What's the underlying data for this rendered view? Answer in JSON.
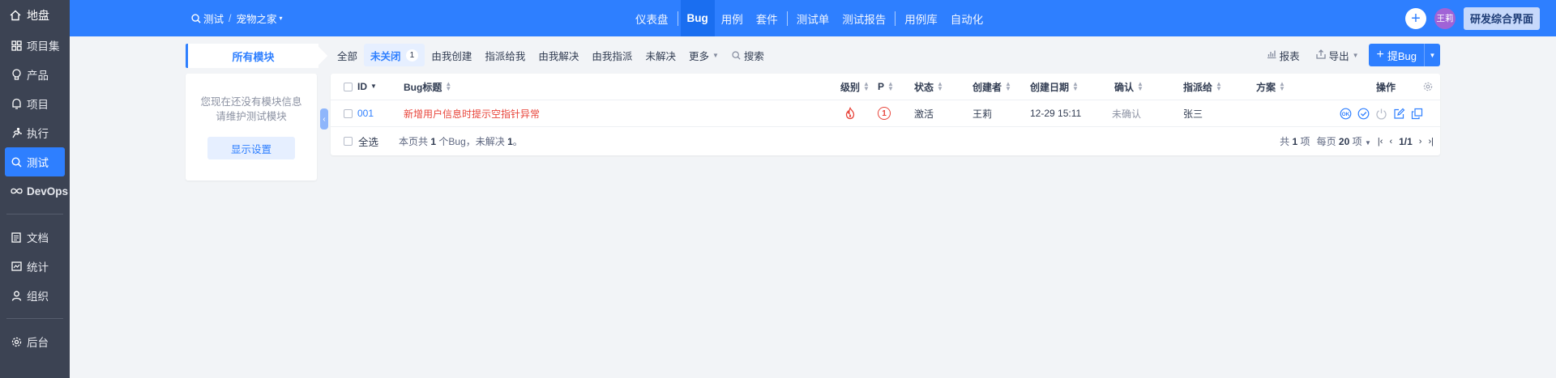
{
  "sidebar": {
    "items": [
      {
        "label": "地盘",
        "icon": "home-icon",
        "active": false
      },
      {
        "label": "项目集",
        "icon": "grid-icon",
        "active": false
      },
      {
        "label": "产品",
        "icon": "lightbulb-icon",
        "active": false
      },
      {
        "label": "项目",
        "icon": "bell-icon",
        "active": false
      },
      {
        "label": "执行",
        "icon": "run-icon",
        "active": false
      },
      {
        "label": "测试",
        "icon": "search-icon",
        "active": true
      },
      {
        "label": "DevOps",
        "icon": "infinity-icon",
        "active": false
      },
      {
        "label": "文档",
        "icon": "doc-icon",
        "active": false
      },
      {
        "label": "统计",
        "icon": "chart-icon",
        "active": false
      },
      {
        "label": "组织",
        "icon": "user-icon",
        "active": false
      },
      {
        "label": "后台",
        "icon": "gear-icon",
        "active": false
      }
    ]
  },
  "header": {
    "breadcrumb": {
      "section": "测试",
      "product": "宠物之家"
    },
    "nav": [
      "仪表盘",
      "Bug",
      "用例",
      "套件",
      "测试单",
      "测试报告",
      "用例库",
      "自动化"
    ],
    "active_nav": "Bug",
    "avatar_text": "王莉",
    "switch_label": "研发综合界面"
  },
  "module": {
    "tab_label": "所有模块",
    "empty_message_line1": "您现在还没有模块信息",
    "empty_message_line2": "请维护测试模块",
    "settings_button": "显示设置"
  },
  "filters": {
    "items": [
      "全部",
      "未关闭",
      "由我创建",
      "指派给我",
      "由我解决",
      "由我指派",
      "未解决",
      "更多"
    ],
    "active": "未关闭",
    "active_count": "1",
    "search_label": "搜索"
  },
  "actions": {
    "report_label": "报表",
    "export_label": "导出",
    "add_bug_label": "提Bug"
  },
  "table": {
    "headers": {
      "id": "ID",
      "title": "Bug标题",
      "severity": "级别",
      "priority": "P",
      "status": "状态",
      "creator": "创建者",
      "created_date": "创建日期",
      "confirmed": "确认",
      "assigned_to": "指派给",
      "resolution": "方案",
      "operations": "操作"
    },
    "rows": [
      {
        "id": "001",
        "title": "新增用户信息时提示空指针异常",
        "severity": "fire-icon",
        "priority": "1",
        "status": "激活",
        "creator": "王莉",
        "created_date": "12-29 15:11",
        "confirmed": "未确认",
        "assigned_to": "张三",
        "resolution": ""
      }
    ],
    "select_all_label": "全选",
    "summary": {
      "prefix": "本页共",
      "count": "1",
      "middle": "个Bug，未解决",
      "unresolved": "1",
      "suffix": "。"
    },
    "pager": {
      "total_prefix": "共",
      "total": "1",
      "total_suffix": "项",
      "per_page_prefix": "每页",
      "per_page": "20",
      "per_page_suffix": "项",
      "page": "1/1"
    }
  },
  "colors": {
    "primary": "#2e7fff",
    "sidebar": "#3c4353",
    "danger": "#e8443a"
  }
}
